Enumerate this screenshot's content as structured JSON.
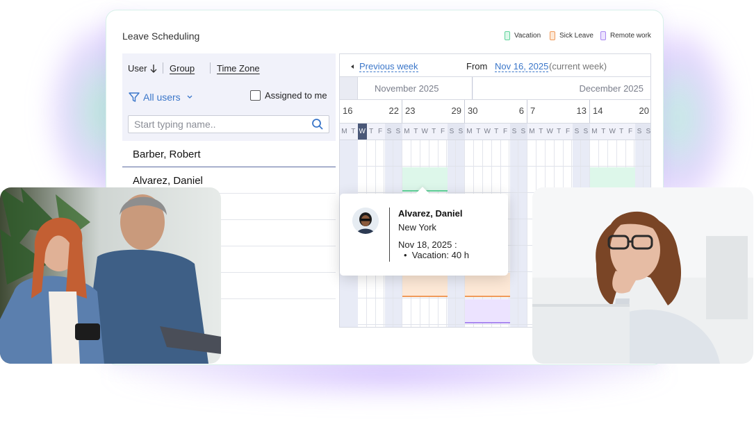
{
  "app": {
    "title": "Leave Scheduling"
  },
  "legend": [
    {
      "label": "Vacation",
      "color": "#5fd39a",
      "fill": "#ddf7ea"
    },
    {
      "label": "Sick Leave",
      "color": "#ef9a5a",
      "fill": "#fde8d6"
    },
    {
      "label": "Remote work",
      "color": "#a887f0",
      "fill": "#ece3ff"
    }
  ],
  "sort": {
    "user": "User",
    "group": "Group",
    "timezone": "Time Zone"
  },
  "filter": {
    "label": "All users",
    "assigned_label": "Assigned to me"
  },
  "search": {
    "placeholder": "Start typing name.."
  },
  "users": [
    "Barber, Robert",
    "Alvarez, Daniel"
  ],
  "calendar": {
    "nav_prev": "Previous week",
    "from_label": "From",
    "from_date": "Nov 16, 2025",
    "from_note": "(current week)",
    "months": [
      "November 2025",
      "December 2025"
    ],
    "weeks": [
      {
        "start": "16",
        "end": "22"
      },
      {
        "start": "23",
        "end": "29"
      },
      {
        "start": "30",
        "end": "6"
      },
      {
        "start": "7",
        "end": "13"
      },
      {
        "start": "14",
        "end": "20"
      }
    ],
    "day_letters": [
      "M",
      "T",
      "W",
      "T",
      "F",
      "S",
      "S"
    ],
    "today_day": "W"
  },
  "tooltip": {
    "name": "Alvarez, Daniel",
    "location": "New York",
    "date": "Nov 18, 2025 :",
    "item": "Vacation: 40 h"
  },
  "colors": {
    "accent": "#3a76c9",
    "panel_bg": "#f1f2fa",
    "today": "#4a5878",
    "weekend": "#e8ebf6"
  }
}
